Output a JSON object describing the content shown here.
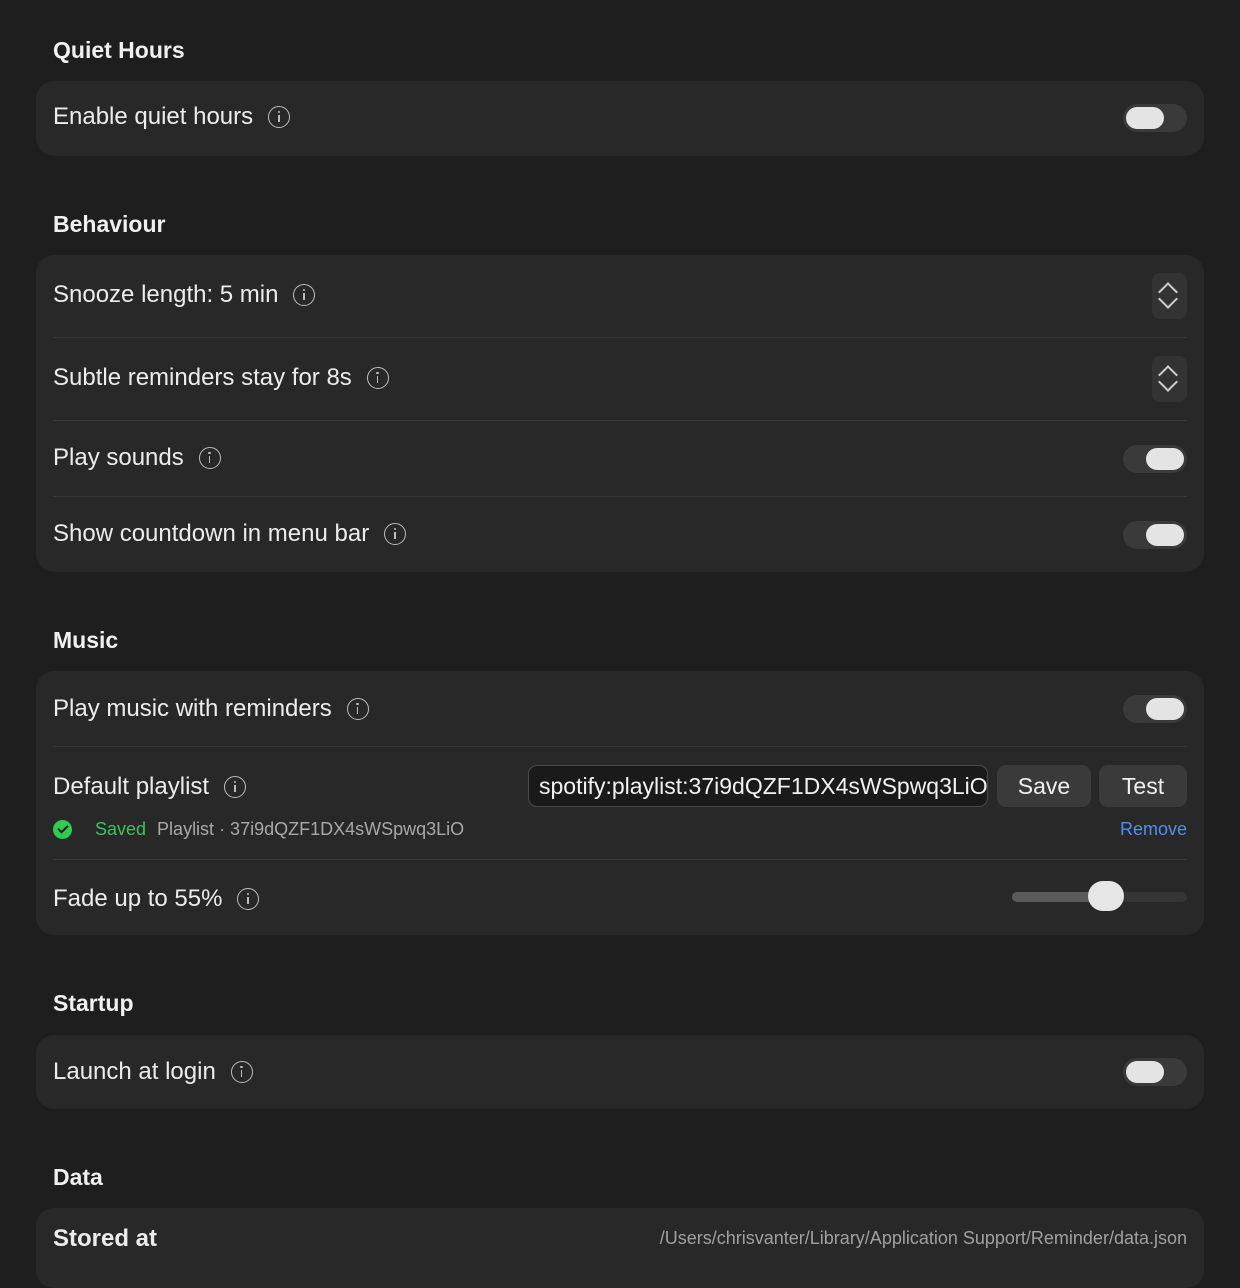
{
  "quiet_hours": {
    "title": "Quiet Hours",
    "enable_label": "Enable quiet hours",
    "enabled": false
  },
  "behaviour": {
    "title": "Behaviour",
    "snooze_label": "Snooze length: 5 min",
    "subtle_label": "Subtle reminders stay for 8s",
    "sounds_label": "Play sounds",
    "sounds_on": true,
    "countdown_label": "Show countdown in menu bar",
    "countdown_on": true
  },
  "music": {
    "title": "Music",
    "play_label": "Play music with reminders",
    "play_on": true,
    "playlist_label": "Default playlist",
    "playlist_value": "spotify:playlist:37i9dQZF1DX4sWSpwq3LiO",
    "save_label": "Save",
    "test_label": "Test",
    "status_saved": "Saved",
    "status_playlist": "Playlist · 37i9dQZF1DX4sWSpwq3LiO",
    "remove_label": "Remove",
    "fade_label": "Fade up to 55%",
    "fade_level": 0.55
  },
  "startup": {
    "title": "Startup",
    "launch_label": "Launch at login",
    "launch_on": false
  },
  "data_section": {
    "title": "Data",
    "stored_label": "Stored at",
    "stored_path": "/Users/chrisvanter/Library/Application Support/Reminder/data.json"
  },
  "colors": {
    "background": "#1e1e1e",
    "card": "#282828",
    "accent_green": "#34c759",
    "link_blue": "#4f8ef7"
  }
}
